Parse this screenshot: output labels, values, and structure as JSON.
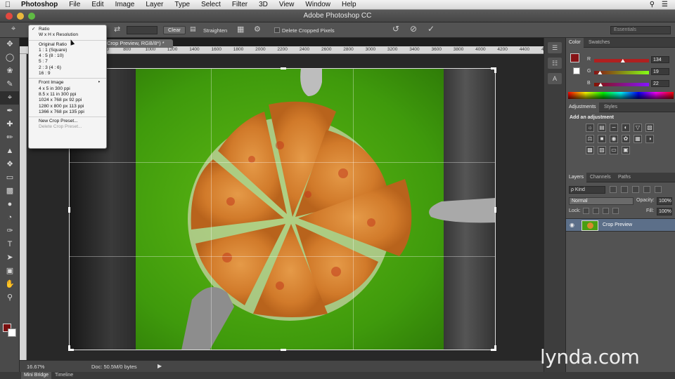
{
  "menubar": {
    "items": [
      "Photoshop",
      "File",
      "Edit",
      "Image",
      "Layer",
      "Type",
      "Select",
      "Filter",
      "3D",
      "View",
      "Window",
      "Help"
    ]
  },
  "titlebar": {
    "title": "Adobe Photoshop CC"
  },
  "options": {
    "clear_label": "Clear",
    "straighten_label": "Straighten",
    "delete_cropped_label": "Delete Cropped Pixels",
    "workspace": "Essentials"
  },
  "crop_menu": {
    "group1": [
      "Ratio",
      "W x H x Resolution"
    ],
    "group2": [
      "Original Ratio",
      "1 : 1 (Square)",
      "4 : 5 (8 : 10)",
      "5 : 7",
      "2 : 3 (4 : 6)",
      "16 : 9"
    ],
    "group3": [
      "Front Image",
      "4 x 5 in 300 ppi",
      "8.5 x 11 in 300 ppi",
      "1024 x 768 px 92 ppi",
      "1280 x 800 px 113 ppi",
      "1366 x 768 px 135 ppi"
    ],
    "group4": [
      "New Crop Preset...",
      "Delete Crop Preset..."
    ]
  },
  "document": {
    "tab_label": "Crop Preview, RGB/8*) *"
  },
  "ruler": {
    "ticks": [
      "600",
      "800",
      "1000",
      "1200",
      "1400",
      "1600",
      "1800",
      "2000",
      "2200",
      "2400",
      "2600",
      "2800",
      "3000",
      "3200",
      "3400",
      "3600",
      "3800",
      "4000",
      "4200",
      "4400",
      "4600"
    ]
  },
  "status": {
    "zoom": "16.67%",
    "doc": "Doc: 50.5M/0 bytes"
  },
  "bottom_tabs": [
    "Mini Bridge",
    "Timeline"
  ],
  "color_panel": {
    "tabs": [
      "Color",
      "Swatches"
    ],
    "r_label": "R",
    "g_label": "G",
    "b_label": "B",
    "r": "134",
    "g": "19",
    "b": "22",
    "r_val": 134,
    "g_val": 19,
    "b_val": 22,
    "fg_color": "#861316"
  },
  "adjustments_panel": {
    "tabs": [
      "Adjustments",
      "Styles"
    ],
    "title": "Add an adjustment"
  },
  "layers_panel": {
    "tabs": [
      "Layers",
      "Channels",
      "Paths"
    ],
    "kind": "ρ Kind",
    "blend": "Normal",
    "opacity_label": "Opacity:",
    "opacity": "100%",
    "lock_label": "Lock:",
    "fill_label": "Fill:",
    "fill": "100%",
    "layers": [
      {
        "name": "Crop Preview"
      }
    ]
  },
  "watermark": "lynda.com"
}
